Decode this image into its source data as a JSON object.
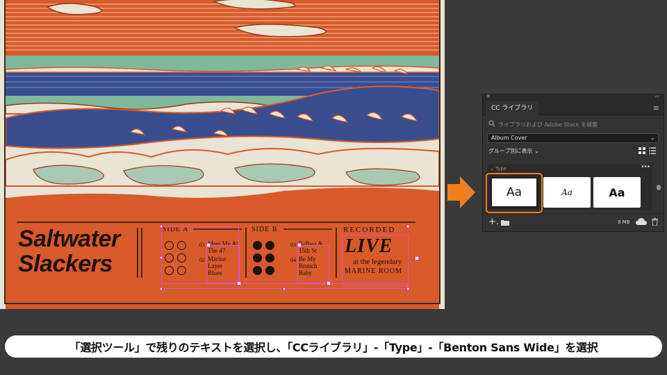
{
  "artwork": {
    "band_line1": "Saltwater",
    "band_line2": "Slackers",
    "side_a": "SIDE A",
    "side_b": "SIDE B",
    "side_a_tracks": [
      {
        "num": "01",
        "title": "Meet Me At The 47"
      },
      {
        "num": "02",
        "title": "Marine Layer Blues"
      }
    ],
    "side_b_tracks": [
      {
        "num": "03",
        "title": "Balboa & 15th St"
      },
      {
        "num": "04",
        "title": "Be My Brunch Baby"
      }
    ],
    "recorded": "RECORDED",
    "live": "LIVE",
    "legendary": "at the legendary",
    "marine_room": "MARINE ROOM",
    "colors": {
      "orange": "#d95a2b",
      "blue": "#3a4d8f",
      "green": "#7fb89a",
      "cream": "#e9e4d3",
      "ink": "#1e120c"
    }
  },
  "panel": {
    "tab_label": "CC ライブラリ",
    "search_placeholder": "ライブラリおよび Adobe Stock を検索",
    "library_name": "Album Cover",
    "group_view_label": "グループ別に表示",
    "section_label": "Type",
    "swatches": [
      "Aa",
      "Aa",
      "Aa"
    ],
    "storage": "8 MB",
    "icons": [
      "close-icon",
      "menu-icon",
      "search-icon",
      "chevron-down-icon",
      "grid-view-icon",
      "list-view-icon",
      "more-icon",
      "add-icon",
      "folder-icon",
      "cloud-icon",
      "trash-icon"
    ]
  },
  "highlight_color": "#f07d1e",
  "caption": "「選択ツール」で残りのテキストを選択し、「CCライブラリ」-「Type」-「Benton Sans Wide」を選択"
}
